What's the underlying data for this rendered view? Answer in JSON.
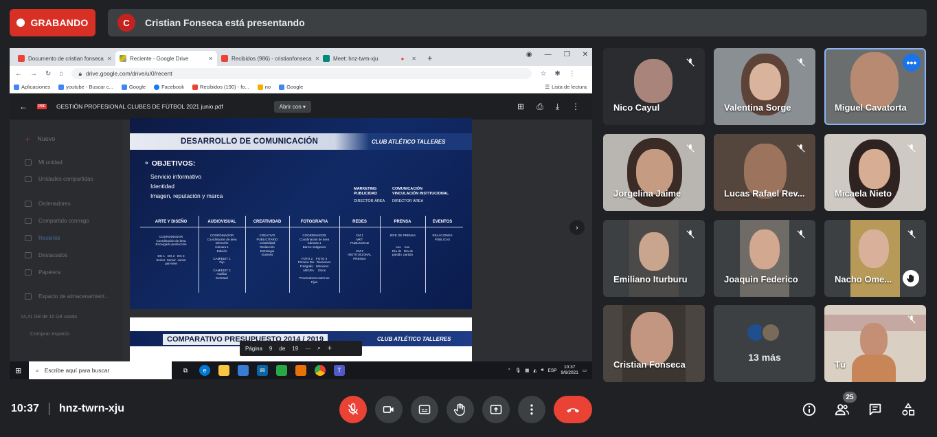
{
  "recording": {
    "label": "GRABANDO"
  },
  "presenter": {
    "initial": "C",
    "text": "Cristian Fonseca está presentando"
  },
  "browser": {
    "tabs": [
      {
        "label": "Documento de cristian fonseca"
      },
      {
        "label": "Reciente - Google Drive"
      },
      {
        "label": "Recibidos (986) - cristianfonseca"
      },
      {
        "label": "Meet: hnz-twm-xju"
      }
    ],
    "url": "drive.google.com/drive/u/0/recent",
    "bookmarks": [
      "Aplicaciones",
      "youtube - Buscar c...",
      "Google",
      "Facebook",
      "Recibidos (190) - fo...",
      "no",
      "Google"
    ],
    "reading_list": "Lista de lectura"
  },
  "drive_sidebar": {
    "new_label": "Nuevo",
    "items": [
      "Mi unidad",
      "Unidades compartidas",
      "Ordenadores",
      "Compartido conmigo",
      "Reciente",
      "Destacados",
      "Papelera",
      "Espacio de almacenamient...",
      "14,41 GB de 15 GB usado",
      "Comprar espacio"
    ]
  },
  "pdf": {
    "filename": "GESTIÓN PROFESIONAL CLUBES DE FÚTBOL 2021 junio.pdf",
    "open_with": "Abrir con",
    "slide1": {
      "title": "DESARROLLO DE COMUNICACIÓN",
      "brand": "CLUB ATLÉTICO TALLERES",
      "objectives_title": "OBJETIVOS:",
      "objectives": [
        "Servicio informativo",
        "Identidad",
        "Imagen, reputación y marca"
      ],
      "right_blocks": [
        {
          "line1": "MARKETING",
          "line2": "PUBLICIDAD",
          "line3": "DIRECTOR ÁREA"
        },
        {
          "line1": "COMUNICACIÓN",
          "line2": "VINCULACIÓN INSTITUCIONAL",
          "line3": "DIRECTOR ÁREA"
        }
      ],
      "columns": [
        {
          "head": "ARTE Y DISEÑO",
          "body": "COORDINADOR\nCoordinación de área\nEncargado producción\n\n\nDG 1   DG 2   DG 3\nSenior  Senior  Junior\npart-time"
        },
        {
          "head": "AUDIOVISUAL",
          "body": "COORDINADOR\nCoordinación de área\nDirección\nCámara 1\nEdición\n\nCAM/EDIT 1\nFijo\n\nCAM/EDIT 2\nAuxiliar\nEventual"
        },
        {
          "head": "CREATIVIDAD",
          "body": "CREATIVO\nPUBLICITARIO\nCreatividad\nRedacción\nEstrategia\nGuiones"
        },
        {
          "head": "FOTOGRAFIA",
          "body": "COORDINADOR\nCoordinación de área\nCámara 1\nBanco imágenes\n\n\nFOTO 2    FOTO 3\nPrimera Div.  Divisiones\nFotógrafo   Inferiores\nARGRA     Otros\n\nProveedores externos\nFijos"
        },
        {
          "head": "REDES",
          "body": "CM 1\nMKT\nPUBLICIDAD\n\nCM 2\nINSTITUCIONAL\nPRENSA"
        },
        {
          "head": "PRENSA",
          "body": "JEFE DE PRENSA\n\n\nAux    Aux\nDía de   Día de\npartido  partido"
        },
        {
          "head": "EVENTOS",
          "body": "RELACIONES\nPÚBLICAS"
        }
      ]
    },
    "slide2": {
      "title": "COMPARATIVO PRESUPUESTO 2014 / 2019",
      "brand": "CLUB ATLÉTICO TALLERES"
    },
    "pager": {
      "label": "Página",
      "current": "9",
      "of": "de",
      "total": "19"
    }
  },
  "taskbar": {
    "search_placeholder": "Escribe aquí para buscar",
    "lang": "ESP",
    "time": "10:37",
    "date": "9/6/2021"
  },
  "participants": [
    {
      "name": "Nico Cayul"
    },
    {
      "name": "Valentina Sorge"
    },
    {
      "name": "Miguel Cavatorta"
    },
    {
      "name": "Jorgelina Jaime"
    },
    {
      "name": "Lucas Rafael Rev..."
    },
    {
      "name": "Micaela Nieto"
    },
    {
      "name": "Emiliano Iturburu"
    },
    {
      "name": "Joaquin Federico"
    },
    {
      "name": "Nacho Ome..."
    },
    {
      "name": "Cristian Fonseca"
    },
    {
      "name": "13 más"
    },
    {
      "name": "Tú"
    }
  ],
  "meeting": {
    "time": "10:37",
    "code": "hnz-twrn-xju",
    "participants_count": "25"
  },
  "colors": {
    "recording": "#d93025",
    "end_call": "#ea4335",
    "speaker_outline": "#8ab4f8",
    "background": "#202124",
    "tile": "#3c4043"
  }
}
